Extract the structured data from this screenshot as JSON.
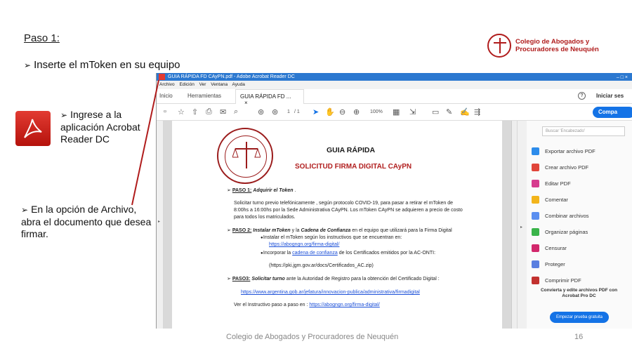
{
  "slide": {
    "title": "Paso 1:",
    "bullet1": "Inserte el mToken en su equipo",
    "bullet2": "Ingrese a la aplicación Acrobat Reader DC",
    "bullet3": "En la opción de Archivo, abra el documento  que desea firmar.",
    "bullet_arrow": "➢",
    "logo_line1": "Colegio de Abogados y",
    "logo_line2": "Procuradores de Neuquén",
    "footer_org": "Colegio de Abogados y Procuradores de Neuquén",
    "footer_page": "16",
    "accent_color": "#b01c1c"
  },
  "acrobat": {
    "window_title": "GUIA  RÁPIDA FD CAyPN.pdf - Adobe Acrobat Reader DC",
    "menu": [
      "Archivo",
      "Edición",
      "Ver",
      "Ventana",
      "Ayuda"
    ],
    "tabs": {
      "home": "Inicio",
      "tools": "Herramientas",
      "document": "GUIA  RÁPIDA FD ...",
      "close": "×"
    },
    "help": "?",
    "signin": "Iniciar ses",
    "toolbar": {
      "page_current": "1",
      "page_total": "/ 1",
      "zoom": "100%"
    },
    "share_label": "Compa",
    "left_chevron": "▸",
    "right_chevron": "▸",
    "right_panel": {
      "search_placeholder": "Buscar 'Encabezado'",
      "items": [
        {
          "label": "Exportar archivo PDF",
          "icon": "export-pdf-icon",
          "color": "#2d8ceb"
        },
        {
          "label": "Crear archivo PDF",
          "icon": "create-pdf-icon",
          "color": "#e0453a"
        },
        {
          "label": "Editar PDF",
          "icon": "edit-pdf-icon",
          "color": "#d63b8f"
        },
        {
          "label": "Comentar",
          "icon": "comment-icon",
          "color": "#f2b41b"
        },
        {
          "label": "Combinar archivos",
          "icon": "combine-files-icon",
          "color": "#5a8ff0"
        },
        {
          "label": "Organizar páginas",
          "icon": "organize-pages-icon",
          "color": "#3ab44a"
        },
        {
          "label": "Censurar",
          "icon": "redact-icon",
          "color": "#d2286c"
        },
        {
          "label": "Proteger",
          "icon": "protect-icon",
          "color": "#5a7fe0"
        },
        {
          "label": "Comprimir PDF",
          "icon": "compress-pdf-icon",
          "color": "#c2312f"
        }
      ],
      "promo": "Convierta y edite archivos PDF con Acrobat Pro DC",
      "trial_button": "Empezar prueba gratuita"
    }
  },
  "pdf": {
    "title": "GUIA  RÁPIDA",
    "subtitle": "SOLICITUD FIRMA DIGITAL CAyPN",
    "paso1_label": "PASO 1:",
    "paso1_title": "Adquirir  el Token",
    "paso1_text_a": "Solicitar turno previo telefónicamente , según protocolo COVID-19,  para pasar a retirar el mToken  de",
    "paso1_text_b": "8:00hs a 16:00hs por la Sede Administrativa CAyPN. Los mToken CAyPN se adquieren a precio de costo",
    "paso1_text_c": "para todos los matriculados.",
    "paso2_label": "PASO 2:",
    "paso2_a": "Instalar mToken",
    "paso2_b": " y la ",
    "paso2_c": "Cadena de Confianza",
    "paso2_d": " en el equipo que utilizará para la Firma Digital",
    "paso2_bullet1": "Instalar el mToken según los instructivos que se encuentran en:",
    "paso2_link1": "https://abogngn.org/firma-digital/",
    "paso2_bullet2_a": "Incorporar la ",
    "paso2_bullet2_link": "cadena de confianza",
    "paso2_bullet2_b": " de los Certificados  emitidos por la AC-ONTI:",
    "paso2_url": "(https://pki.jgm.gov.ar/docs/Certificados_AC.zip)",
    "paso3_label": "PASO3:",
    "paso3_title": "Solicitar turno",
    "paso3_text": "  ante la Autoridad de Registro para la obtención del Certificado Digital :",
    "paso3_link": "https://www.argentina.gob.ar/jefatura/innovacion-publica/administrativa/firmadigital",
    "paso3_instr": "Ver el Instructivo paso a paso en : ",
    "paso3_instr_link": "https://abogngn.org/firma-digital/"
  }
}
